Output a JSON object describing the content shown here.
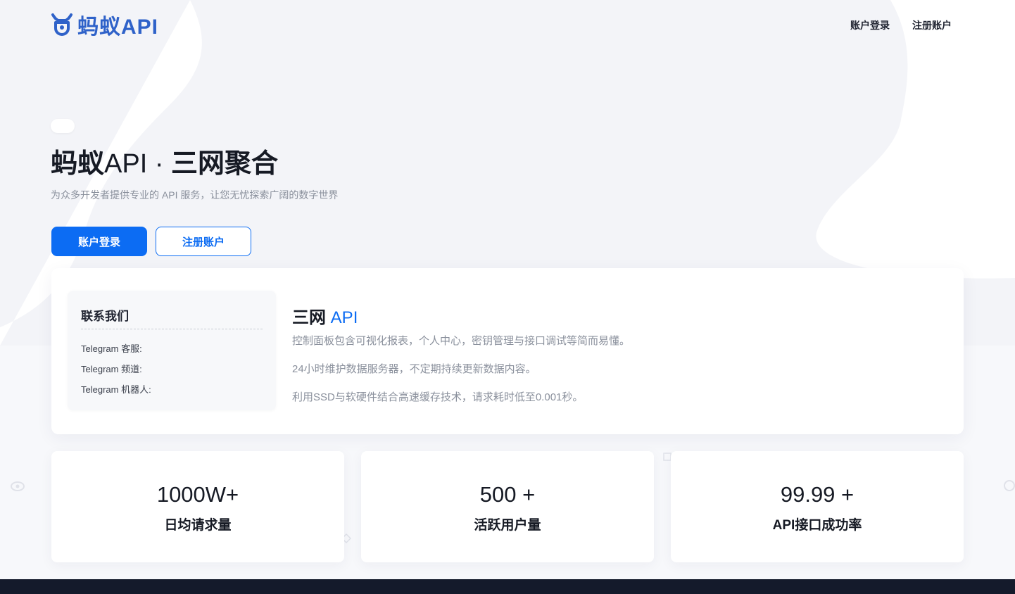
{
  "header": {
    "logo_text": "蚂蚁API",
    "nav": [
      {
        "label": "账户登录"
      },
      {
        "label": "注册账户"
      }
    ]
  },
  "hero": {
    "title_part1": "蚂蚁",
    "title_part2": "API · ",
    "title_part3": "三网聚合",
    "subtitle": "为众多开发者提供专业的 API 服务，让您无忧探索广阔的数字世界",
    "login_button": "账户登录",
    "register_button": "注册账户"
  },
  "contact": {
    "title": "联系我们",
    "items": [
      "Telegram 客服:",
      "Telegram 频道:",
      "Telegram 机器人:"
    ]
  },
  "feature": {
    "title_dark": "三网",
    "title_blue": "API",
    "lines": [
      "控制面板包含可视化报表，个人中心，密钥管理与接口调试等简而易懂。",
      "24小时维护数据服务器，不定期持续更新数据内容。",
      "利用SSD与软硬件结合高速缓存技术，请求耗时低至0.001秒。"
    ]
  },
  "stats": [
    {
      "value": "1000W+",
      "label": "日均请求量"
    },
    {
      "value": "500 +",
      "label": "活跃用户量"
    },
    {
      "value": "99.99 +",
      "label": "API接口成功率"
    }
  ],
  "colors": {
    "accent": "#0c6cf3",
    "logo": "#2f62c9",
    "footer": "#141a2b"
  }
}
